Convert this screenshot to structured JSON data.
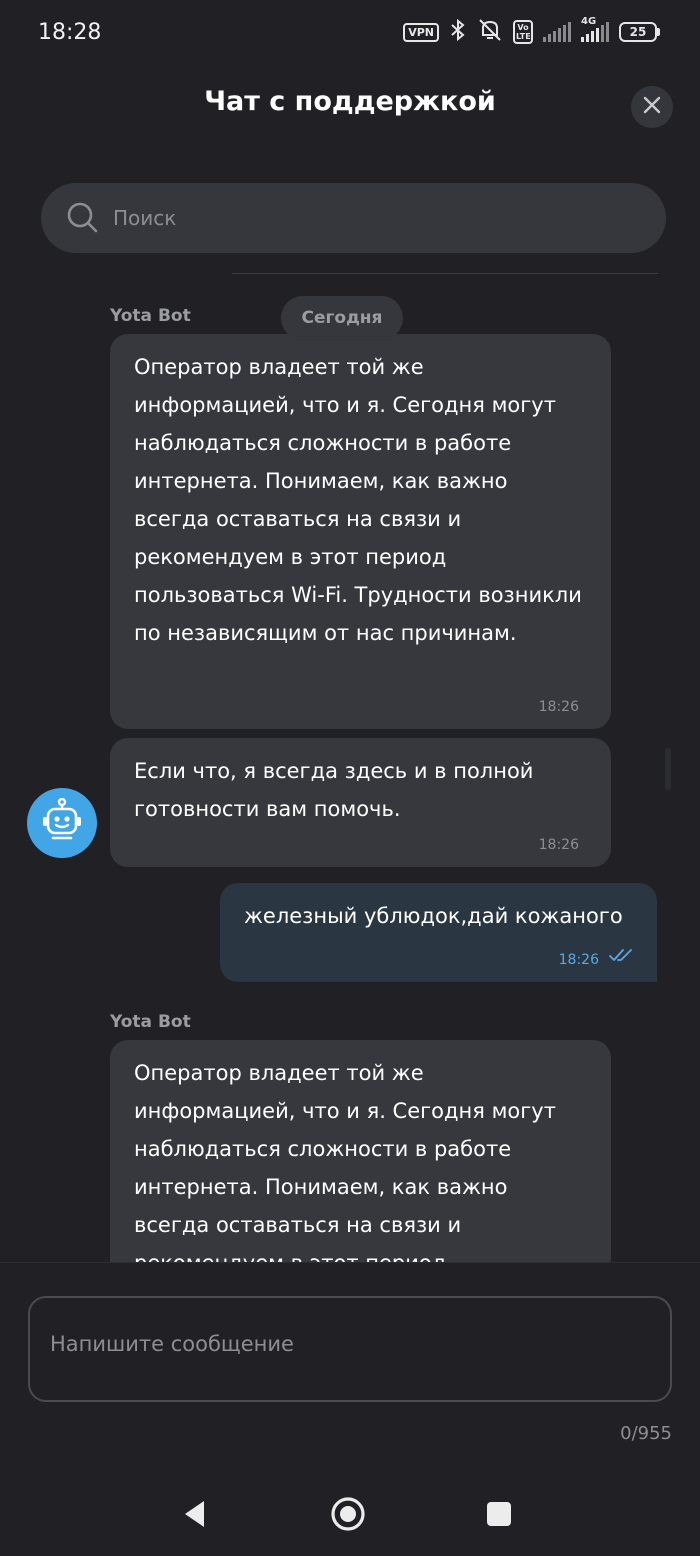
{
  "status_bar": {
    "time": "18:28",
    "vpn": "VPN",
    "volte": "Vo LTE",
    "net": "4G",
    "battery": "25",
    "icons": [
      "vpn-icon",
      "bluetooth-icon",
      "mute-icon",
      "volte-icon",
      "signal-icon",
      "signal-4g-icon",
      "battery-icon"
    ]
  },
  "header": {
    "title": "Чат с поддержкой",
    "close_icon": "close-icon"
  },
  "search": {
    "placeholder": "Поиск",
    "value": ""
  },
  "messages": {
    "date_label": "Сегодня",
    "items": [
      {
        "sender": "Yota Bot",
        "direction": "incoming",
        "text": "Оператор владеет той же информацией, что и я. Сегодня могут наблюдаться сложности в работе интернета. Понимаем, как важно всегда оставаться на связи и рекомендуем в этот период пользоваться Wi-Fi. Трудности возникли по независящим от нас причинам.",
        "time": "18:26"
      },
      {
        "direction": "incoming",
        "text": "Если что, я всегда здесь и в полной готовности вам помочь.",
        "time": "18:26"
      },
      {
        "direction": "outgoing",
        "text": "железный ублюдок,дай кожаного",
        "time": "18:26",
        "status": "read"
      },
      {
        "sender": "Yota Bot",
        "direction": "incoming",
        "text": "Оператор владеет той же информацией, что и я. Сегодня могут наблюдаться сложности в работе интернета. Понимаем, как важно всегда оставаться на связи и рекомендуем в этот период"
      }
    ]
  },
  "composer": {
    "placeholder": "Напишите сообщение",
    "value": "",
    "counter": "0/955"
  },
  "nav": {
    "back_icon": "back-icon",
    "home_icon": "home-icon",
    "recents_icon": "recents-icon"
  },
  "colors": {
    "background": "#212125",
    "incoming_bubble": "#37383e",
    "outgoing_bubble": "#2a3641",
    "accent": "#41a5e6"
  }
}
